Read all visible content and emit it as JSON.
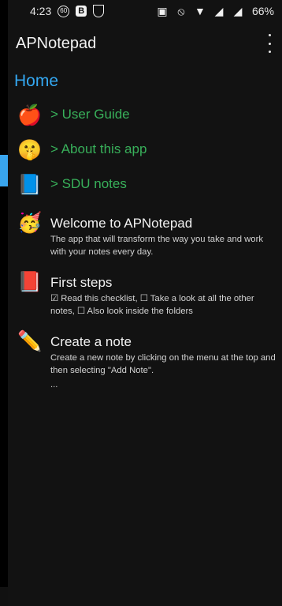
{
  "status_bar": {
    "time": "4:23",
    "battery": "66%",
    "left_icons": [
      "badge-icon",
      "b-icon",
      "shield-icon"
    ],
    "right_icons": [
      "nfc-icon",
      "mute-icon",
      "wifi-icon",
      "signal-icon",
      "signal-icon"
    ]
  },
  "topbar": {
    "title": "APNotepad",
    "menu_icon": "more-vert-icon"
  },
  "home": {
    "title": "Home",
    "links": [
      {
        "emoji": "🍎",
        "label": "> User Guide"
      },
      {
        "emoji": "🤫",
        "label": "> About this app"
      },
      {
        "emoji": "📘",
        "label": "> SDU notes"
      }
    ]
  },
  "notes": [
    {
      "emoji": "🥳",
      "title": "Welcome to APNotepad",
      "text": "The app that will transform the way you take and work with your notes every day."
    },
    {
      "emoji": "📕",
      "title": "First steps",
      "text": "☑ Read this checklist, ☐ Take a look at all the other notes, ☐ Also look inside the folders"
    },
    {
      "emoji": "✏️",
      "title": "Create a note",
      "text": "Create a new note by clicking on the menu at the top and then selecting \"Add Note\".",
      "more": "..."
    }
  ],
  "colors": {
    "background": "#121212",
    "accent": "#34a8f2",
    "link": "#38b05a"
  }
}
